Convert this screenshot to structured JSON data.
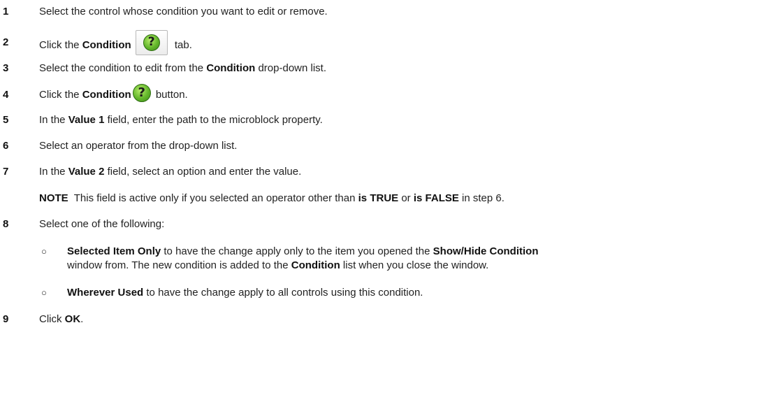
{
  "steps": [
    {
      "num": "1",
      "parts": [
        "Select the control whose condition you want to edit or remove."
      ]
    },
    {
      "num": "2",
      "pre": "Click the ",
      "bold": "Condition",
      "post": " tab.",
      "icon": "help-icon"
    },
    {
      "num": "3",
      "pre": "Select the condition to edit from the ",
      "bold": "Condition",
      "post": " drop-down list."
    },
    {
      "num": "4",
      "pre": "Click the ",
      "bold": "Condition",
      "post": " button.",
      "icon": "help-icon"
    },
    {
      "num": "5",
      "pre": "In the ",
      "bold": "Value 1",
      "post": " field, enter the path to the microblock property."
    },
    {
      "num": "6",
      "text": "Select an operator from the drop-down list."
    },
    {
      "num": "7",
      "pre": "In the ",
      "bold": "Value 2",
      "post": " field, select an option and enter the value."
    },
    {
      "num": "8",
      "text": "Select one of the following:"
    },
    {
      "num": "9",
      "pre": "Click ",
      "bold": "OK",
      "post": "."
    }
  ],
  "step1_text": "Select the control whose condition you want to edit or remove.",
  "note": {
    "label": "NOTE",
    "pre": "  This field is active only if you selected an operator other than ",
    "bold1": "is TRUE",
    "mid": " or ",
    "bold2": "is FALSE",
    "post": " in step 6."
  },
  "options": [
    {
      "bullet": "○",
      "bold": "Selected Item Only",
      "pre": " to have the change apply only to the item you opened the ",
      "bold2": "Show/Hide Condition",
      "line2_pre": "window from. The new condition is added to the ",
      "line2_bold": "Condition",
      "line2_post": " list when you close the window."
    },
    {
      "bullet": "○",
      "bold": "Wherever Used",
      "post": " to have the change apply to all controls using this condition."
    }
  ],
  "icons": {
    "help_glyph": "?",
    "help_name": "help-icon",
    "help_color": "#63b62b"
  }
}
